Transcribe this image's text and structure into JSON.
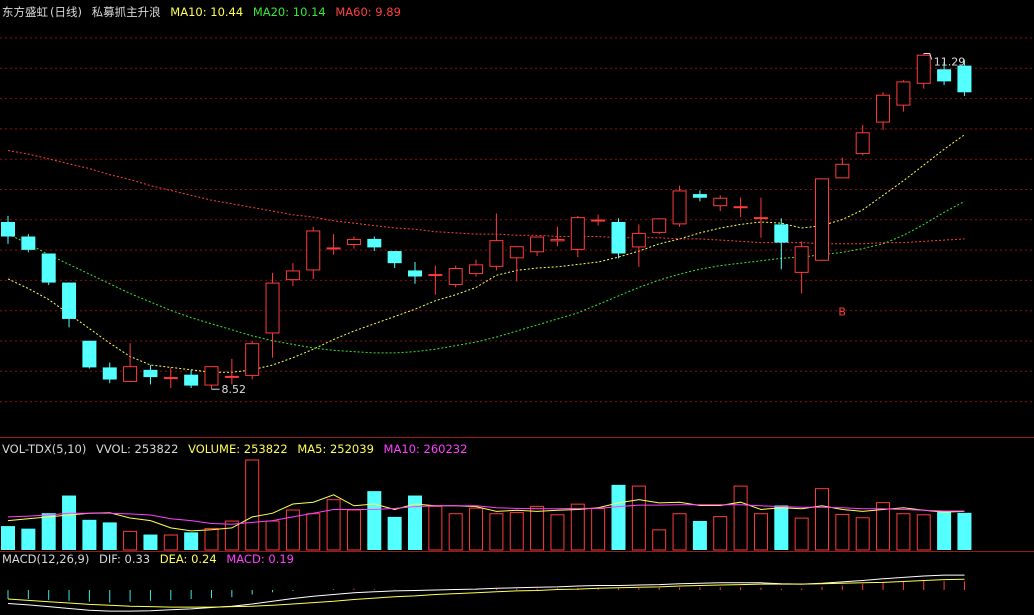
{
  "header": {
    "stock": "东方盛虹",
    "period": "(日线)",
    "indicator": "私募抓主升浪",
    "ma10": "MA10: 10.44",
    "ma20": "MA20: 10.14",
    "ma60": "MA60: 9.89"
  },
  "vol_header": {
    "name": "VOL-TDX(5,10)",
    "vvol": "VVOL: 253822",
    "volume": "VOLUME: 253822",
    "ma5": "MA5: 252039",
    "ma10": "MA10: 260232"
  },
  "macd_header": {
    "name": "MACD(12,26,9)",
    "dif": "DIF: 0.33",
    "dea": "DEA: 0.24",
    "macd": "MACD: 0.19"
  },
  "colors": {
    "up": "#ff3b3b",
    "down": "#54ffff",
    "ma10": "#ffff54",
    "ma20": "#36e836",
    "ma60": "#ff4040",
    "grid": "#8a1010",
    "vol_ma5": "#ffff54",
    "vol_ma10": "#ff40ff"
  },
  "chart_data": [
    {
      "type": "candlestick",
      "title": "东方盛虹 (日线)",
      "ylim": [
        8.2,
        11.55
      ],
      "annotations": [
        {
          "text": "11.29",
          "kind": "high"
        },
        {
          "text": "8.52",
          "kind": "low"
        },
        {
          "text": "B",
          "kind": "buy-signal"
        }
      ],
      "candles": [
        {
          "o": 9.9,
          "h": 9.95,
          "l": 9.72,
          "c": 9.78
        },
        {
          "o": 9.78,
          "h": 9.8,
          "l": 9.65,
          "c": 9.67
        },
        {
          "o": 9.64,
          "h": 9.64,
          "l": 9.38,
          "c": 9.4
        },
        {
          "o": 9.4,
          "h": 9.4,
          "l": 9.03,
          "c": 9.1
        },
        {
          "o": 8.92,
          "h": 8.92,
          "l": 8.69,
          "c": 8.7
        },
        {
          "o": 8.7,
          "h": 8.74,
          "l": 8.57,
          "c": 8.6
        },
        {
          "o": 8.58,
          "h": 8.9,
          "l": 8.58,
          "c": 8.71
        },
        {
          "o": 8.68,
          "h": 8.72,
          "l": 8.56,
          "c": 8.62
        },
        {
          "o": 8.62,
          "h": 8.7,
          "l": 8.53,
          "c": 8.62
        },
        {
          "o": 8.64,
          "h": 8.68,
          "l": 8.53,
          "c": 8.55
        },
        {
          "o": 8.55,
          "h": 8.71,
          "l": 8.52,
          "c": 8.71
        },
        {
          "o": 8.63,
          "h": 8.77,
          "l": 8.56,
          "c": 8.63
        },
        {
          "o": 8.63,
          "h": 8.92,
          "l": 8.6,
          "c": 8.9
        },
        {
          "o": 8.98,
          "h": 9.48,
          "l": 8.78,
          "c": 9.4
        },
        {
          "o": 9.42,
          "h": 9.56,
          "l": 9.37,
          "c": 9.5
        },
        {
          "o": 9.5,
          "h": 9.86,
          "l": 9.43,
          "c": 9.83
        },
        {
          "o": 9.69,
          "h": 9.8,
          "l": 9.63,
          "c": 9.69
        },
        {
          "o": 9.71,
          "h": 9.78,
          "l": 9.68,
          "c": 9.76
        },
        {
          "o": 9.76,
          "h": 9.78,
          "l": 9.66,
          "c": 9.69
        },
        {
          "o": 9.66,
          "h": 9.66,
          "l": 9.52,
          "c": 9.56
        },
        {
          "o": 9.5,
          "h": 9.57,
          "l": 9.39,
          "c": 9.45
        },
        {
          "o": 9.47,
          "h": 9.54,
          "l": 9.3,
          "c": 9.47
        },
        {
          "o": 9.38,
          "h": 9.54,
          "l": 9.36,
          "c": 9.52
        },
        {
          "o": 9.47,
          "h": 9.59,
          "l": 9.45,
          "c": 9.55
        },
        {
          "o": 9.53,
          "h": 9.97,
          "l": 9.5,
          "c": 9.75
        },
        {
          "o": 9.6,
          "h": 9.7,
          "l": 9.41,
          "c": 9.7
        },
        {
          "o": 9.65,
          "h": 9.78,
          "l": 9.62,
          "c": 9.78
        },
        {
          "o": 9.74,
          "h": 9.86,
          "l": 9.7,
          "c": 9.76
        },
        {
          "o": 9.67,
          "h": 9.95,
          "l": 9.61,
          "c": 9.94
        },
        {
          "o": 9.92,
          "h": 9.96,
          "l": 9.87,
          "c": 9.92
        },
        {
          "o": 9.9,
          "h": 9.93,
          "l": 9.6,
          "c": 9.64
        },
        {
          "o": 9.69,
          "h": 9.88,
          "l": 9.53,
          "c": 9.81
        },
        {
          "o": 9.81,
          "h": 9.93,
          "l": 9.8,
          "c": 9.93
        },
        {
          "o": 9.88,
          "h": 10.2,
          "l": 9.86,
          "c": 10.16
        },
        {
          "o": 10.13,
          "h": 10.16,
          "l": 10.07,
          "c": 10.1
        },
        {
          "o": 10.03,
          "h": 10.12,
          "l": 9.99,
          "c": 10.1
        },
        {
          "o": 10.02,
          "h": 10.1,
          "l": 9.94,
          "c": 10.03
        },
        {
          "o": 9.94,
          "h": 10.1,
          "l": 9.77,
          "c": 9.94
        },
        {
          "o": 9.88,
          "h": 9.93,
          "l": 9.51,
          "c": 9.73
        },
        {
          "o": 9.48,
          "h": 9.74,
          "l": 9.31,
          "c": 9.7
        },
        {
          "o": 9.58,
          "h": 10.26,
          "l": 9.58,
          "c": 10.26
        },
        {
          "o": 10.26,
          "h": 10.43,
          "l": 10.26,
          "c": 10.38
        },
        {
          "o": 10.46,
          "h": 10.7,
          "l": 10.45,
          "c": 10.64
        },
        {
          "o": 10.72,
          "h": 10.97,
          "l": 10.66,
          "c": 10.95
        },
        {
          "o": 10.86,
          "h": 11.07,
          "l": 10.81,
          "c": 11.06
        },
        {
          "o": 11.04,
          "h": 11.29,
          "l": 11.0,
          "c": 11.28
        },
        {
          "o": 11.16,
          "h": 11.22,
          "l": 11.03,
          "c": 11.06
        },
        {
          "o": 11.19,
          "h": 11.24,
          "l": 10.94,
          "c": 10.97
        }
      ],
      "series": [
        {
          "name": "MA10",
          "values": [
            9.43,
            9.35,
            9.26,
            9.14,
            9.02,
            8.9,
            8.79,
            8.72,
            8.7,
            8.68,
            8.66,
            8.66,
            8.68,
            8.72,
            8.78,
            8.85,
            8.93,
            9.0,
            9.06,
            9.12,
            9.18,
            9.25,
            9.3,
            9.36,
            9.46,
            9.5,
            9.52,
            9.53,
            9.55,
            9.57,
            9.61,
            9.66,
            9.72,
            9.76,
            9.81,
            9.85,
            9.88,
            9.9,
            9.89,
            9.85,
            9.87,
            9.92,
            10.0,
            10.12,
            10.24,
            10.37,
            10.5,
            10.62
          ]
        },
        {
          "name": "MA20",
          "values": [
            9.8,
            9.72,
            9.63,
            9.55,
            9.47,
            9.39,
            9.31,
            9.24,
            9.17,
            9.11,
            9.06,
            9.01,
            8.96,
            8.92,
            8.89,
            8.86,
            8.84,
            8.83,
            8.82,
            8.82,
            8.83,
            8.85,
            8.88,
            8.91,
            8.95,
            9.0,
            9.05,
            9.1,
            9.15,
            9.22,
            9.29,
            9.36,
            9.42,
            9.47,
            9.51,
            9.54,
            9.56,
            9.58,
            9.6,
            9.61,
            9.63,
            9.65,
            9.68,
            9.72,
            9.79,
            9.88,
            9.98,
            10.07
          ]
        },
        {
          "name": "MA60",
          "values": [
            10.49,
            10.46,
            10.42,
            10.38,
            10.34,
            10.29,
            10.25,
            10.2,
            10.16,
            10.12,
            10.08,
            10.05,
            10.02,
            9.99,
            9.96,
            9.94,
            9.91,
            9.89,
            9.87,
            9.85,
            9.84,
            9.82,
            9.81,
            9.8,
            9.8,
            9.79,
            9.79,
            9.78,
            9.78,
            9.78,
            9.77,
            9.77,
            9.77,
            9.76,
            9.76,
            9.75,
            9.74,
            9.73,
            9.73,
            9.73,
            9.72,
            9.72,
            9.72,
            9.73,
            9.73,
            9.74,
            9.75,
            9.76
          ]
        }
      ]
    },
    {
      "type": "bar",
      "title": "VOL-TDX(5,10)",
      "volumes": [
        65,
        58,
        100,
        148,
        82,
        75,
        52,
        42,
        42,
        48,
        60,
        80,
        246,
        80,
        110,
        100,
        138,
        110,
        160,
        90,
        148,
        120,
        100,
        115,
        100,
        103,
        120,
        97,
        126,
        114,
        177,
        175,
        56,
        100,
        79,
        92,
        175,
        100,
        121,
        88,
        168,
        98,
        89,
        130,
        100,
        97,
        107,
        101
      ],
      "series": [
        {
          "name": "MA5",
          "values": [
            80,
            85,
            90,
            95,
            100,
            101,
            87,
            80,
            60,
            52,
            55,
            60,
            90,
            100,
            125,
            130,
            150,
            120,
            125,
            110,
            125,
            120,
            120,
            118,
            105,
            108,
            105,
            108,
            110,
            115,
            128,
            137,
            128,
            130,
            121,
            121,
            130,
            110,
            115,
            112,
            120,
            110,
            105,
            110,
            115,
            108,
            103,
            105
          ]
        },
        {
          "name": "MA10",
          "values": [
            90,
            92,
            95,
            100,
            100,
            100,
            98,
            95,
            85,
            80,
            72,
            70,
            75,
            80,
            90,
            100,
            110,
            110,
            110,
            113,
            118,
            120,
            120,
            120,
            115,
            113,
            112,
            112,
            113,
            113,
            118,
            122,
            122,
            123,
            123,
            123,
            123,
            120,
            118,
            116,
            116,
            115,
            112,
            112,
            110,
            108,
            106,
            106
          ]
        }
      ]
    },
    {
      "type": "bar",
      "title": "MACD(12,26,9)",
      "hist": [
        -0.2,
        -0.2,
        -0.22,
        -0.24,
        -0.26,
        -0.28,
        -0.26,
        -0.24,
        -0.22,
        -0.2,
        -0.18,
        -0.16,
        -0.1,
        -0.05,
        -0.02,
        0.0,
        0.02,
        0.03,
        0.02,
        0.01,
        0.0,
        0.0,
        0.01,
        0.02,
        0.03,
        0.03,
        0.03,
        0.04,
        0.05,
        0.05,
        0.04,
        0.04,
        0.05,
        0.06,
        0.06,
        0.06,
        0.06,
        0.05,
        0.03,
        0.03,
        0.07,
        0.1,
        0.14,
        0.17,
        0.2,
        0.21,
        0.2,
        0.19
      ],
      "series": [
        {
          "name": "DIF",
          "values": [
            -0.3,
            -0.33,
            -0.37,
            -0.41,
            -0.45,
            -0.47,
            -0.47,
            -0.46,
            -0.44,
            -0.42,
            -0.39,
            -0.36,
            -0.31,
            -0.25,
            -0.19,
            -0.14,
            -0.1,
            -0.06,
            -0.04,
            -0.02,
            -0.01,
            0.0,
            0.01,
            0.02,
            0.04,
            0.05,
            0.06,
            0.07,
            0.09,
            0.1,
            0.1,
            0.11,
            0.12,
            0.14,
            0.15,
            0.16,
            0.16,
            0.16,
            0.14,
            0.13,
            0.15,
            0.18,
            0.21,
            0.25,
            0.28,
            0.31,
            0.33,
            0.33
          ]
        },
        {
          "name": "DEA",
          "values": [
            -0.2,
            -0.23,
            -0.26,
            -0.29,
            -0.32,
            -0.34,
            -0.36,
            -0.37,
            -0.38,
            -0.38,
            -0.38,
            -0.37,
            -0.36,
            -0.34,
            -0.31,
            -0.28,
            -0.25,
            -0.21,
            -0.18,
            -0.15,
            -0.13,
            -0.1,
            -0.08,
            -0.06,
            -0.04,
            -0.02,
            -0.01,
            0.01,
            0.02,
            0.04,
            0.05,
            0.06,
            0.07,
            0.09,
            0.1,
            0.11,
            0.12,
            0.13,
            0.13,
            0.13,
            0.14,
            0.15,
            0.16,
            0.17,
            0.19,
            0.21,
            0.23,
            0.24
          ]
        }
      ]
    }
  ]
}
